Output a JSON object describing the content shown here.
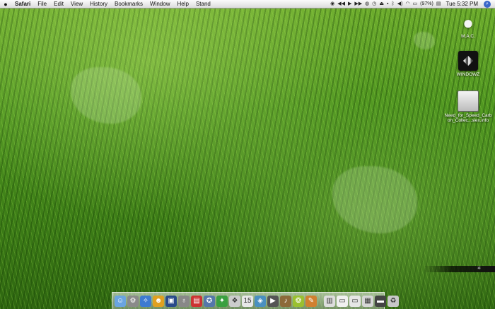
{
  "menubar": {
    "apple": "",
    "items": [
      "Safari",
      "File",
      "Edit",
      "View",
      "History",
      "Bookmarks",
      "Window",
      "Help",
      "Stand"
    ],
    "battery": "(97%)",
    "clock": "Tue 5:32 PM"
  },
  "desktop": {
    "icons": [
      {
        "label": "M.A.C.",
        "icon": "apple-icon"
      },
      {
        "label": "WINDOWZ",
        "icon": "windows-drive-icon"
      },
      {
        "label": "Need_for_Speed_Carbon_Collec...siex.info",
        "icon": "disk-image-icon"
      }
    ]
  },
  "corner_strip": {
    "logo": "✲"
  },
  "dock": {
    "icons": [
      {
        "name": "finder-icon",
        "color": "#6aa4e0",
        "glyph": "☺"
      },
      {
        "name": "system-prefs-icon",
        "color": "#8a8a8a",
        "glyph": "⚙"
      },
      {
        "name": "safari-icon",
        "color": "#3e7ad1",
        "glyph": "✧"
      },
      {
        "name": "app-icon-4",
        "color": "#e0a020",
        "glyph": "☻"
      },
      {
        "name": "photo-icon",
        "color": "#2a4a8a",
        "glyph": "▣"
      },
      {
        "name": "app-icon-6",
        "color": "#888888",
        "glyph": "♁"
      },
      {
        "name": "app-icon-7",
        "color": "#cc3333",
        "glyph": "▤"
      },
      {
        "name": "app-icon-8",
        "color": "#5577aa",
        "glyph": "✪"
      },
      {
        "name": "app-icon-9",
        "color": "#3aa040",
        "glyph": "✦"
      },
      {
        "name": "app-icon-10",
        "color": "#cccccc",
        "glyph": "❖"
      },
      {
        "name": "calendar-icon",
        "color": "#e8e8e8",
        "glyph": "15"
      },
      {
        "name": "app-icon-12",
        "color": "#4a90c0",
        "glyph": "◈"
      },
      {
        "name": "dvd-icon",
        "color": "#555555",
        "glyph": "▶"
      },
      {
        "name": "app-icon-14",
        "color": "#8c6a3a",
        "glyph": "♪"
      },
      {
        "name": "app-icon-15",
        "color": "#9ac030",
        "glyph": "❂"
      },
      {
        "name": "app-icon-16",
        "color": "#d08030",
        "glyph": "✎"
      },
      {
        "name": "doc-icon-1",
        "color": "#dddddd",
        "glyph": "▥"
      },
      {
        "name": "doc-icon-2",
        "color": "#f0f0f0",
        "glyph": "▭"
      },
      {
        "name": "doc-icon-3",
        "color": "#e6e6e6",
        "glyph": "▭"
      },
      {
        "name": "doc-icon-4",
        "color": "#d6d6d6",
        "glyph": "▦"
      },
      {
        "name": "doc-icon-5",
        "color": "#444444",
        "glyph": "▬"
      },
      {
        "name": "trash-icon",
        "color": "#c8c8c8",
        "glyph": "♻"
      }
    ]
  }
}
